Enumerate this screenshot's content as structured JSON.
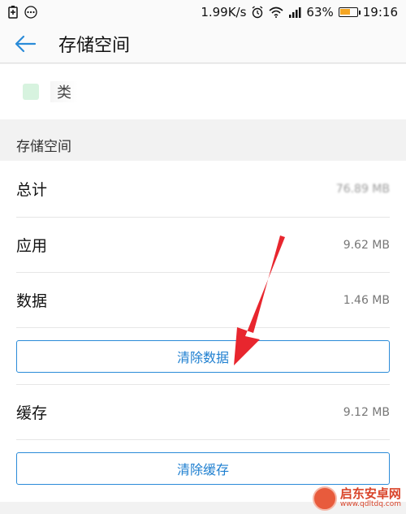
{
  "status_bar": {
    "speed": "1.99K/s",
    "battery_percent": "63%",
    "battery_level": 0.63,
    "time": "19:16"
  },
  "app_bar": {
    "title": "存储空间"
  },
  "app_header": {
    "name": "类"
  },
  "section": {
    "title": "存储空间"
  },
  "rows": {
    "total": {
      "label": "总计",
      "value": "76.89 MB"
    },
    "apps": {
      "label": "应用",
      "value": "9.62 MB"
    },
    "data": {
      "label": "数据",
      "value": "1.46 MB"
    },
    "cache": {
      "label": "缓存",
      "value": "9.12 MB"
    }
  },
  "buttons": {
    "clear_data": "清除数据",
    "clear_cache": "清除缓存"
  },
  "watermark": {
    "title": "启东安卓网",
    "url": "www.qdltdq.com"
  },
  "colors": {
    "accent": "#2a8bd8",
    "arrow": "#e8262e",
    "battery": "#f5a623"
  }
}
